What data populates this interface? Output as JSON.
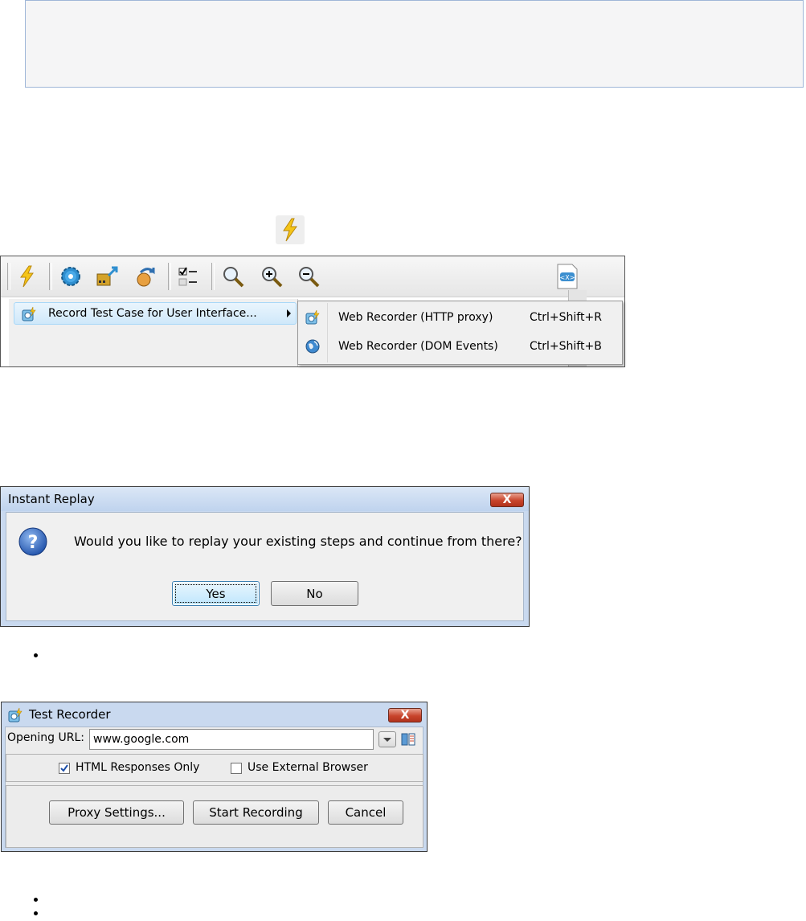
{
  "toolbar_menu": {
    "menu_item_record": "Record Test Case for User Interface...",
    "submenu": [
      {
        "label": "Web Recorder (HTTP proxy)",
        "shortcut": "Ctrl+Shift+R",
        "icon": "recorder-icon"
      },
      {
        "label": "Web Recorder (DOM Events)",
        "shortcut": "Ctrl+Shift+B",
        "icon": "globe-icon"
      }
    ]
  },
  "instant_replay": {
    "title": "Instant Replay",
    "message": "Would you like to replay your existing steps and continue from there?",
    "yes_label": "Yes",
    "no_label": "No",
    "close_glyph": "X"
  },
  "test_recorder": {
    "title": "Test Recorder",
    "url_label": "Opening URL:",
    "url_value": "www.google.com",
    "html_only_label": "HTML Responses Only",
    "html_only_checked": true,
    "external_browser_label": "Use External Browser",
    "external_browser_checked": false,
    "proxy_button": "Proxy Settings...",
    "start_button": "Start Recording",
    "cancel_button": "Cancel",
    "close_glyph": "X"
  },
  "colors": {
    "accent_blue": "#3c7fb1",
    "close_red": "#c8442c",
    "bolt_yellow": "#f5c518"
  }
}
